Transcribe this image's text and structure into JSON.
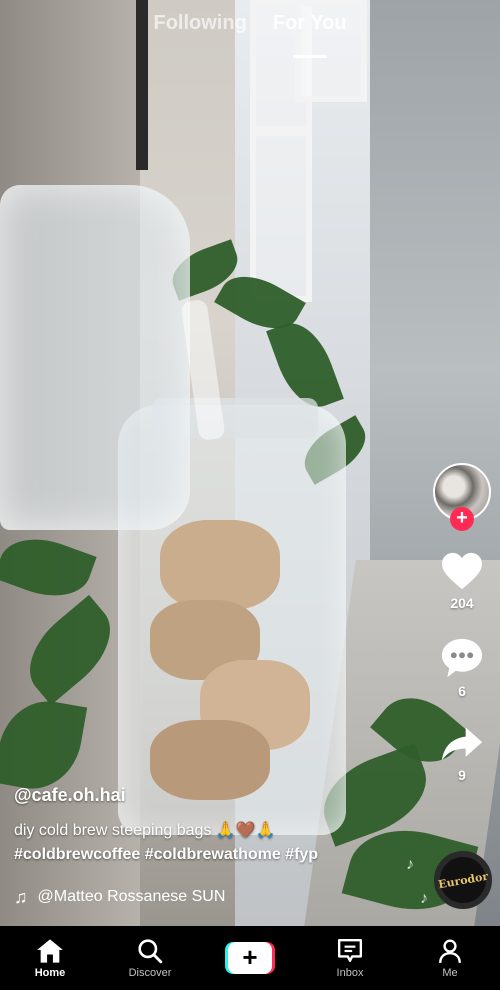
{
  "top_tabs": [
    {
      "label": "Following",
      "active": false
    },
    {
      "label": "For You",
      "active": true
    }
  ],
  "rail": {
    "likes_count": "204",
    "comments_count": "6",
    "shares_count": "9",
    "follow_symbol": "+"
  },
  "caption": {
    "username": "@cafe.oh.hai",
    "description": "diy cold brew steeping bags 🙏🤎🙏",
    "hashtags": "#coldbrewcoffee #coldbrewathome #fyp",
    "music": "@Matteo Rossanese   SUN"
  },
  "music_disc_text": "Eurodor",
  "nav": {
    "items": [
      {
        "label": "Home",
        "icon": "home-icon",
        "active": true
      },
      {
        "label": "Discover",
        "icon": "search-icon",
        "active": false
      },
      {
        "label": "",
        "icon": "create-plus-icon",
        "active": false
      },
      {
        "label": "Inbox",
        "icon": "inbox-icon",
        "active": false
      },
      {
        "label": "Me",
        "icon": "profile-icon",
        "active": false
      }
    ],
    "create_symbol": "+"
  },
  "colors": {
    "accent_red": "#fe2c55",
    "accent_cyan": "#25f4ee",
    "nav_bg": "#000000"
  }
}
